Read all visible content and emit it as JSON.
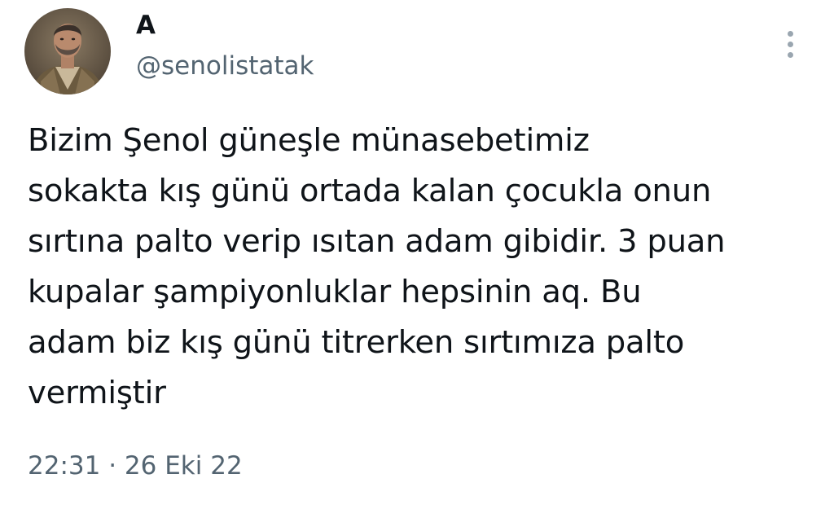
{
  "author": {
    "display_name": "A",
    "handle": "@senolistatak",
    "avatar_icon": "user-avatar-photo"
  },
  "menu": {
    "icon": "more-vertical-icon"
  },
  "tweet": {
    "text": "Bizim Şenol güneşle münasebetimiz\nsokakta kış günü ortada kalan çocukla onun\nsırtına palto verip ısıtan adam gibidir. 3 puan\nkupalar şampiyonluklar hepsinin aq. Bu\nadam biz kış günü titrerken sırtımıza palto\nvermiştir",
    "time": "22:31",
    "separator": "·",
    "date": "26 Eki 22"
  },
  "colors": {
    "text": "#0f1419",
    "secondary": "#536471",
    "background": "#ffffff"
  }
}
